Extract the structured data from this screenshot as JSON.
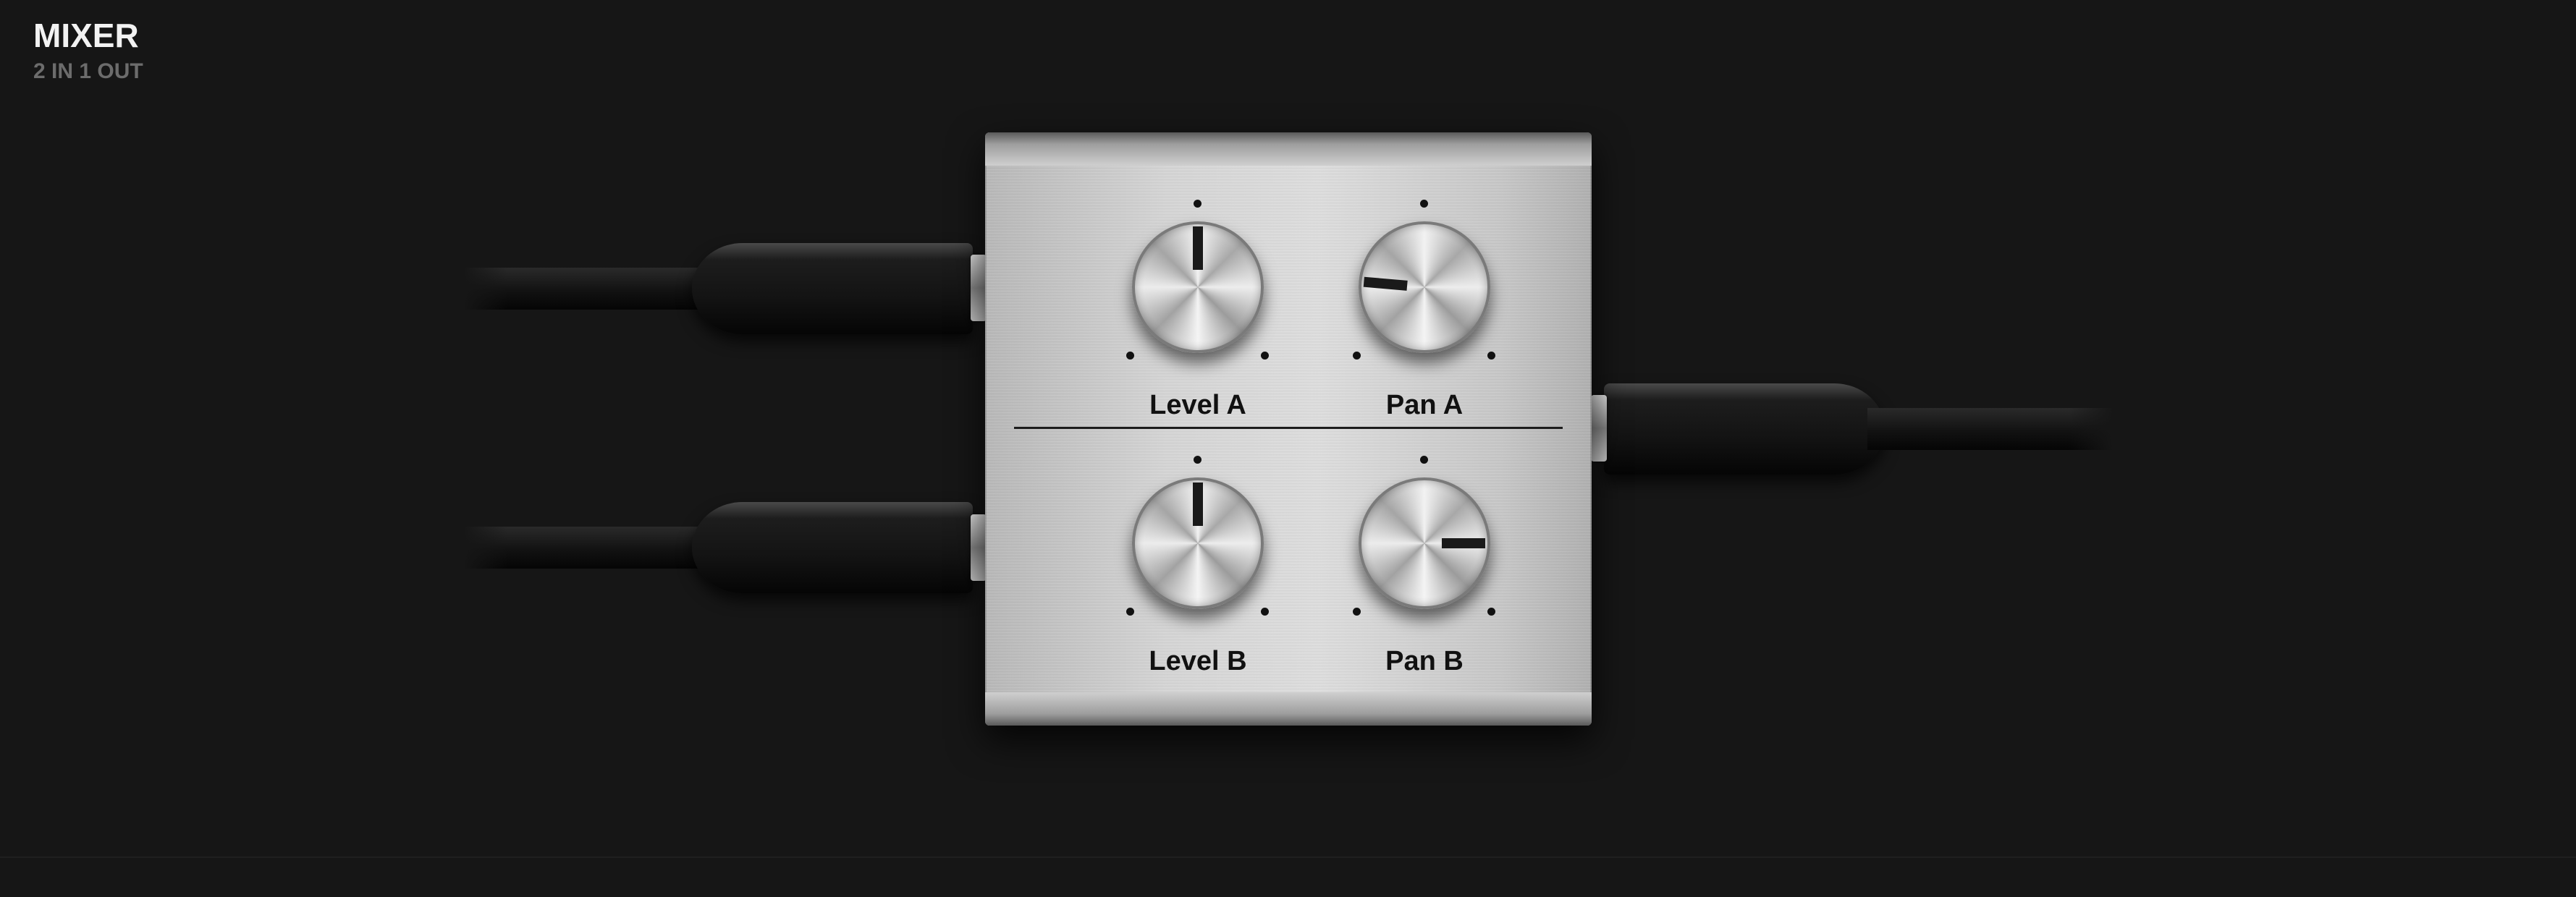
{
  "header": {
    "title": "MIXER",
    "subtitle": "2 IN 1 OUT"
  },
  "ports": {
    "inputs": [
      "input-a",
      "input-b"
    ],
    "outputs": [
      "output"
    ]
  },
  "knobs": [
    {
      "label": "Level A",
      "value_deg": 0
    },
    {
      "label": "Pan A",
      "value_deg": -85
    },
    {
      "label": "Level B",
      "value_deg": 0
    },
    {
      "label": "Pan B",
      "value_deg": 90
    }
  ],
  "colors": {
    "background": "#161616",
    "panel": "#d4d4d4",
    "title": "#f2f2f2",
    "subtitle": "#6c6c6c"
  }
}
